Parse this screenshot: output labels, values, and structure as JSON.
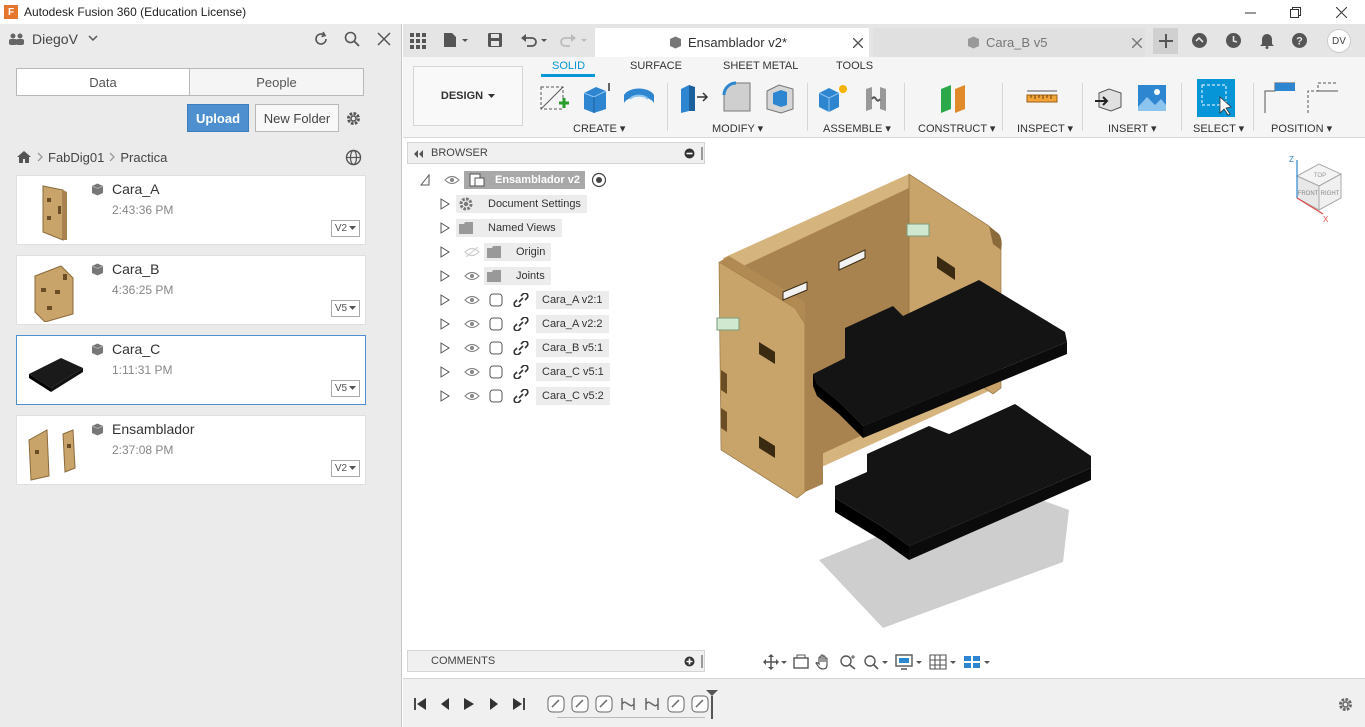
{
  "window": {
    "title": "Autodesk Fusion 360 (Education License)"
  },
  "data_panel": {
    "user": "DiegoV",
    "tabs": [
      "Data",
      "People"
    ],
    "upload_label": "Upload",
    "new_folder_label": "New Folder",
    "breadcrumb": [
      "FabDig01",
      "Practica"
    ],
    "files": [
      {
        "name": "Cara_A",
        "time": "2:43:36 PM",
        "version": "V2"
      },
      {
        "name": "Cara_B",
        "time": "4:36:25 PM",
        "version": "V5"
      },
      {
        "name": "Cara_C",
        "time": "1:11:31 PM",
        "version": "V5"
      },
      {
        "name": "Ensamblador",
        "time": "2:37:08 PM",
        "version": "V2"
      }
    ]
  },
  "doc_tabs": [
    {
      "label": "Ensamblador v2*"
    },
    {
      "label": "Cara_B v5"
    }
  ],
  "avatar": "DV",
  "toolbar": {
    "workspace": "DESIGN",
    "tabs": [
      "SOLID",
      "SURFACE",
      "SHEET METAL",
      "TOOLS"
    ],
    "groups": [
      "CREATE",
      "MODIFY",
      "ASSEMBLE",
      "CONSTRUCT",
      "INSPECT",
      "INSERT",
      "SELECT",
      "POSITION"
    ]
  },
  "browser": {
    "title": "BROWSER",
    "root": "Ensamblador v2",
    "items": [
      "Document Settings",
      "Named Views",
      "Origin",
      "Joints",
      "Cara_A v2:1",
      "Cara_A v2:2",
      "Cara_B v5:1",
      "Cara_C v5:1",
      "Cara_C v5:2"
    ]
  },
  "comments": {
    "title": "COMMENTS"
  },
  "viewcube": {
    "front": "FRONT",
    "right": "RIGHT",
    "top": "TOP",
    "axis_z": "Z",
    "axis_x": "X"
  },
  "colors": {
    "accent": "#0696d7",
    "upload": "#4e8fd0",
    "wood": "#c9a46a",
    "panel": "#1a1a1a"
  }
}
